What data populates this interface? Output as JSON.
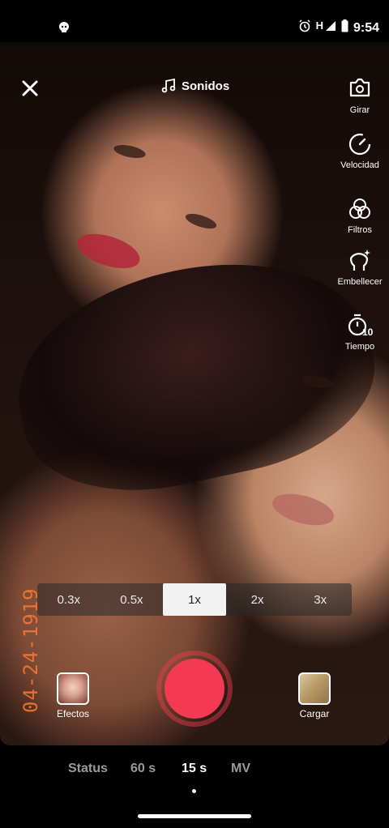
{
  "status_bar": {
    "network_label": "H",
    "time": "9:54"
  },
  "top": {
    "sound_label": "Sonidos"
  },
  "side_tools": [
    {
      "label": "Girar",
      "icon": "flip-camera-icon"
    },
    {
      "label": "Velocidad",
      "icon": "speed-icon"
    },
    {
      "label": "Filtros",
      "icon": "filters-icon"
    },
    {
      "label": "Embellecer",
      "icon": "beautify-icon"
    },
    {
      "label": "Tiempo",
      "icon": "timer-icon"
    }
  ],
  "zoom": {
    "options": [
      "0.3x",
      "0.5x",
      "1x",
      "2x",
      "3x"
    ],
    "selected": "1x"
  },
  "timestamp_overlay": "04-24-1919",
  "bottom": {
    "effects_label": "Efectos",
    "upload_label": "Cargar"
  },
  "modes": {
    "items": [
      "Status",
      "60 s",
      "15 s",
      "MV"
    ],
    "selected": "15 s"
  },
  "colors": {
    "record": "#f33a52",
    "timestamp": "#ff7a2e"
  }
}
